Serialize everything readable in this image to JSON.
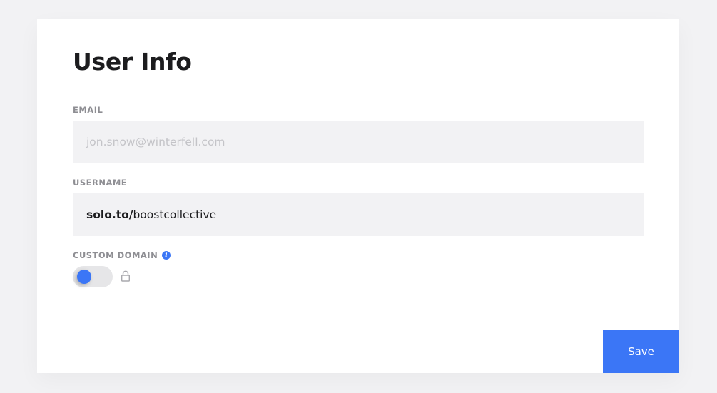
{
  "page": {
    "title": "User Info"
  },
  "email": {
    "label": "EMAIL",
    "value": "",
    "placeholder": "jon.snow@winterfell.com"
  },
  "username": {
    "label": "USERNAME",
    "prefix": "solo.to/",
    "value": "boostcollective"
  },
  "custom_domain": {
    "label": "CUSTOM DOMAIN",
    "info_icon": "info-icon",
    "info_glyph": "i",
    "toggle_on": false,
    "locked": true,
    "lock_icon": "lock-icon"
  },
  "actions": {
    "save_label": "Save"
  },
  "colors": {
    "accent": "#3b76f6",
    "background": "#f2f2f4",
    "card": "#ffffff",
    "field": "#f2f2f4",
    "label": "#8e8e93"
  }
}
